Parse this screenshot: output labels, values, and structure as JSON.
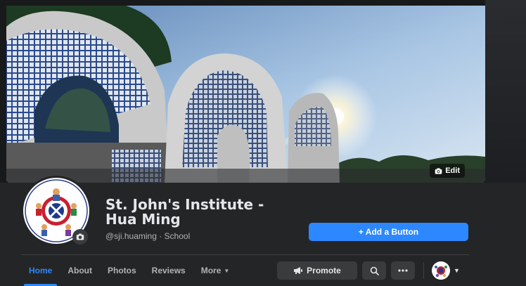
{
  "cover": {
    "edit_label": "Edit"
  },
  "page": {
    "name": "St. John's Institute - Hua Ming",
    "meta": "@sji.huaming · School"
  },
  "actions": {
    "add_button_label": "+ Add a Button",
    "promote_label": "Promote"
  },
  "tabs": [
    {
      "label": "Home"
    },
    {
      "label": "About"
    },
    {
      "label": "Photos"
    },
    {
      "label": "Reviews"
    },
    {
      "label": "More"
    }
  ],
  "colors": {
    "accent": "#2d88ff",
    "background": "#242526",
    "secondary_button": "#3a3b3c"
  },
  "icons": {
    "edit": "camera-icon",
    "promote": "megaphone-icon",
    "search": "search-icon",
    "more": "ellipsis-icon",
    "switch": "chevron-down-icon"
  }
}
